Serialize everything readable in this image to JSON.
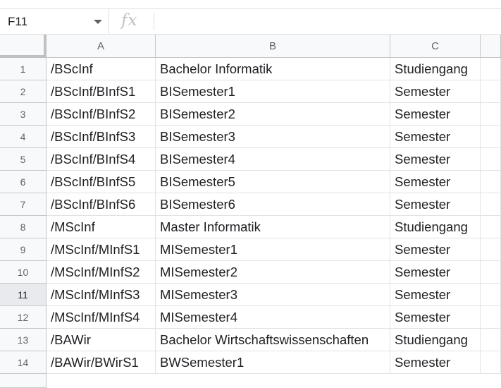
{
  "name_box": {
    "value": "F11"
  },
  "formula_bar": {
    "fx_label": "fx",
    "value": ""
  },
  "columns": [
    "A",
    "B",
    "C"
  ],
  "selected_row": 11,
  "rows": [
    {
      "num": "1",
      "a": "/BScInf",
      "b": "Bachelor Informatik",
      "c": "Studiengang"
    },
    {
      "num": "2",
      "a": "/BScInf/BInfS1",
      "b": "BISemester1",
      "c": "Semester"
    },
    {
      "num": "3",
      "a": "/BScInf/BInfS2",
      "b": "BISemester2",
      "c": "Semester"
    },
    {
      "num": "4",
      "a": "/BScInf/BInfS3",
      "b": "BISemester3",
      "c": "Semester"
    },
    {
      "num": "5",
      "a": "/BScInf/BInfS4",
      "b": "BISemester4",
      "c": "Semester"
    },
    {
      "num": "6",
      "a": "/BScInf/BInfS5",
      "b": "BISemester5",
      "c": "Semester"
    },
    {
      "num": "7",
      "a": "/BScInf/BInfS6",
      "b": "BISemester6",
      "c": "Semester"
    },
    {
      "num": "8",
      "a": "/MScInf",
      "b": "Master Informatik",
      "c": "Studiengang"
    },
    {
      "num": "9",
      "a": "/MScInf/MInfS1",
      "b": "MISemester1",
      "c": "Semester"
    },
    {
      "num": "10",
      "a": "/MScInf/MInfS2",
      "b": "MISemester2",
      "c": "Semester"
    },
    {
      "num": "11",
      "a": "/MScInf/MInfS3",
      "b": "MISemester3",
      "c": "Semester"
    },
    {
      "num": "12",
      "a": "/MScInf/MInfS4",
      "b": "MISemester4",
      "c": "Semester"
    },
    {
      "num": "13",
      "a": "/BAWir",
      "b": "Bachelor Wirtschaftswissenschaften",
      "c": "Studiengang"
    },
    {
      "num": "14",
      "a": "/BAWir/BWirS1",
      "b": "BWSemester1",
      "c": "Semester"
    }
  ]
}
